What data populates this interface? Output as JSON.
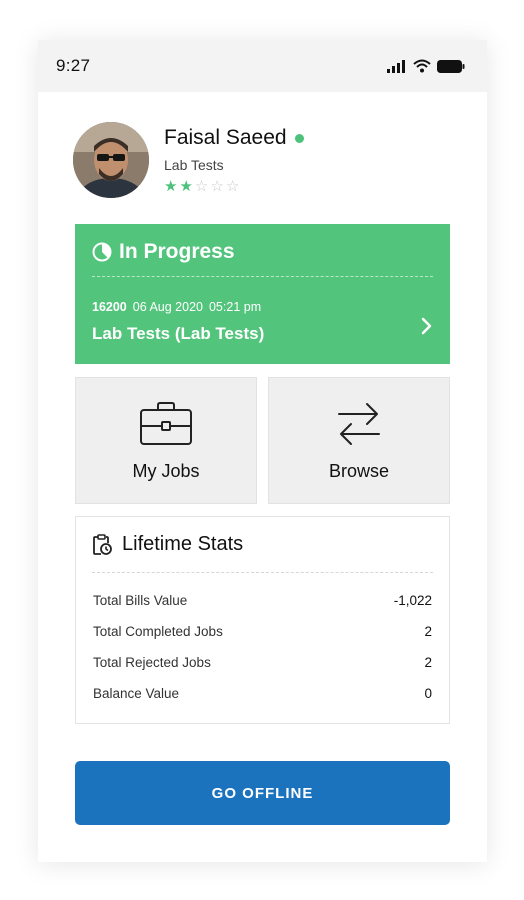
{
  "status_bar": {
    "time": "9:27"
  },
  "profile": {
    "name": "Faisal Saeed",
    "role": "Lab Tests",
    "rating": 2,
    "rating_max": 5,
    "online": true
  },
  "in_progress": {
    "title": "In Progress",
    "job_id": "16200",
    "date": "06 Aug 2020",
    "time": "05:21 pm",
    "job_title": "Lab Tests (Lab Tests)"
  },
  "tiles": {
    "my_jobs": "My Jobs",
    "browse": "Browse"
  },
  "lifetime_stats": {
    "title": "Lifetime Stats",
    "rows": [
      {
        "label": "Total Bills Value",
        "value": "-1,022"
      },
      {
        "label": "Total Completed Jobs",
        "value": "2"
      },
      {
        "label": "Total Rejected Jobs",
        "value": "2"
      },
      {
        "label": "Balance Value",
        "value": "0"
      }
    ]
  },
  "actions": {
    "go_offline": "GO OFFLINE"
  },
  "colors": {
    "accent_green": "#52c47c",
    "primary_blue": "#1b73be",
    "online_dot": "#4cc27a"
  }
}
